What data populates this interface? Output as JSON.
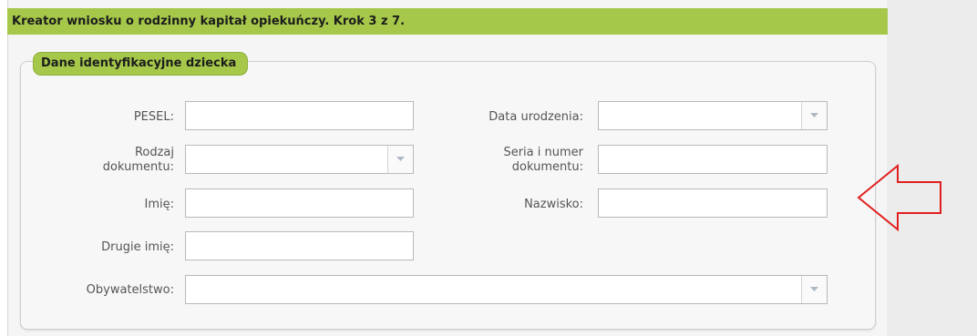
{
  "title": "Kreator wniosku o rodzinny kapitał opiekuńczy. Krok 3 z 7.",
  "section_legend": "Dane identyfikacyjne dziecka",
  "fields": {
    "pesel": {
      "label": "PESEL:",
      "value": ""
    },
    "data_urodzenia": {
      "label": "Data urodzenia:",
      "value": ""
    },
    "rodzaj_dokumentu": {
      "label_line1": "Rodzaj",
      "label_line2": "dokumentu:",
      "value": ""
    },
    "seria_numer": {
      "label_line1": "Seria i numer",
      "label_line2": "dokumentu:",
      "value": ""
    },
    "imie": {
      "label": "Imię:",
      "value": ""
    },
    "nazwisko": {
      "label": "Nazwisko:",
      "value": ""
    },
    "drugie_imie": {
      "label": "Drugie imię:",
      "value": ""
    },
    "obywatelstwo": {
      "label": "Obywatelstwo:",
      "value": ""
    }
  },
  "colors": {
    "accent_green": "#a6c84a",
    "annotation_arrow": "#e02020"
  },
  "icons": {
    "dropdown": "chevron-down-icon",
    "annotation": "arrow-left-icon"
  }
}
